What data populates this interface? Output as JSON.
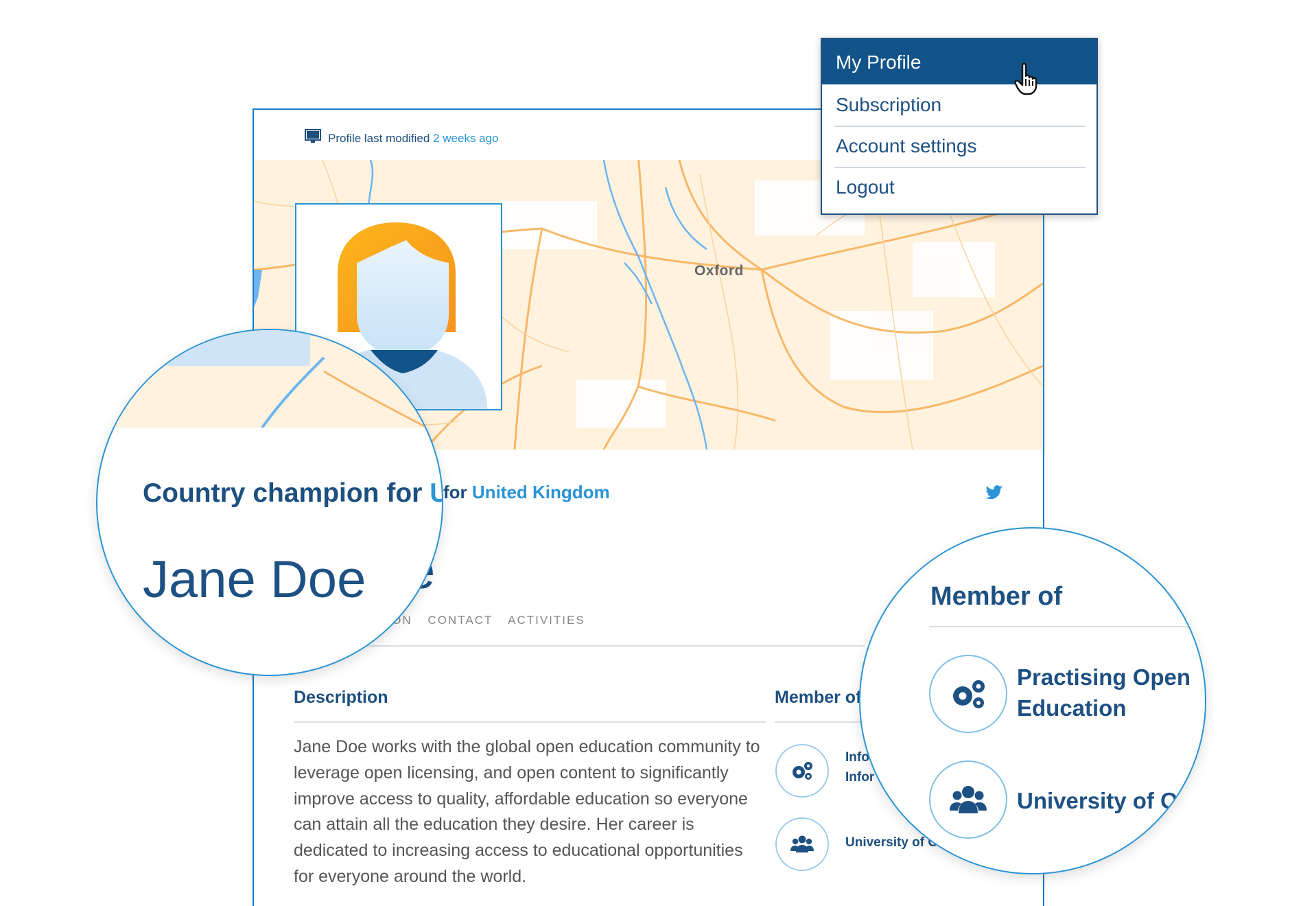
{
  "profile": {
    "modified_label": "Profile last modified",
    "modified_ago": "2 weeks ago",
    "map_city": "Oxford",
    "champion_prefix": "Country champion for",
    "champion_for": "for",
    "country": "United Kingdom",
    "champion_truncated": "Un",
    "name": "Jane Doe",
    "name_fragment": "e",
    "tabs": [
      "ATION",
      "CONTACT",
      "ACTIVITIES"
    ]
  },
  "description": {
    "title": "Description",
    "text": "Jane Doe works with the global open education community to leverage open licensing, and open content to significantly improve access to quality, affordable education so everyone can attain all the education they desire. Her career is dedicated to increasing access to educational opportunities for everyone around the world."
  },
  "member_of": {
    "title": "Member of",
    "small_title": "Member of",
    "small_items": [
      {
        "icon": "gears-icon",
        "line1": "Info",
        "line2": "Infor"
      },
      {
        "icon": "users-icon",
        "line1": "University of O"
      }
    ],
    "zoom_items": [
      {
        "icon": "gears-icon",
        "line1": "Practising Open",
        "line2": "Education"
      },
      {
        "icon": "users-icon",
        "line1": "University of O"
      }
    ]
  },
  "dropdown": {
    "items": [
      "My Profile",
      "Subscription",
      "Account settings",
      "Logout"
    ],
    "active": "My Profile"
  },
  "colors": {
    "primary": "#1e5183",
    "accent": "#2a94d6",
    "map_land": "#fff2df",
    "map_roads": "#f7b868",
    "map_water": "#6cb5f0",
    "avatar_hair_start": "#fcb61a",
    "avatar_hair_end": "#f7931e"
  }
}
